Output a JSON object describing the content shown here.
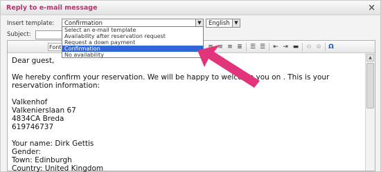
{
  "dialog": {
    "title": "Reply to e-mail message",
    "close_glyph": "×"
  },
  "template": {
    "label": "Insert template:",
    "selected": "Confirmation",
    "options": [
      "Select an e-mail template",
      "Availability after reservation request",
      "Request a down payment",
      "Confirmation",
      "No availability"
    ],
    "highlighted_index": 3
  },
  "language": {
    "selected": "English"
  },
  "subject": {
    "label": "Subject:",
    "value": ""
  },
  "toolbar": {
    "font_label": "Font",
    "icons": [
      "align-left-icon",
      "align-center-icon",
      "align-right-icon",
      "align-justify-icon",
      "ordered-list-icon",
      "unordered-list-icon",
      "outdent-icon",
      "indent-icon",
      "horizontal-rule-icon",
      "link-icon",
      "unlink-icon",
      "special-char-icon"
    ],
    "omega_glyph": "Ω"
  },
  "body": {
    "greeting": "Dear guest,",
    "intro": "We hereby confirm your reservation. We will be happy to welcome you on . This is your reservation information:",
    "address_lines": [
      "Valkenhof",
      "Valkenierslaan 67",
      "4834CA Breda",
      "619746737"
    ],
    "details": [
      "Your name: Dirk Gettis",
      "Gender:",
      "Town: Edinburgh",
      "Country: United Kingdom"
    ]
  },
  "colors": {
    "title": "#c0306e",
    "selection": "#3166d6",
    "pointer": "#e2347a"
  }
}
